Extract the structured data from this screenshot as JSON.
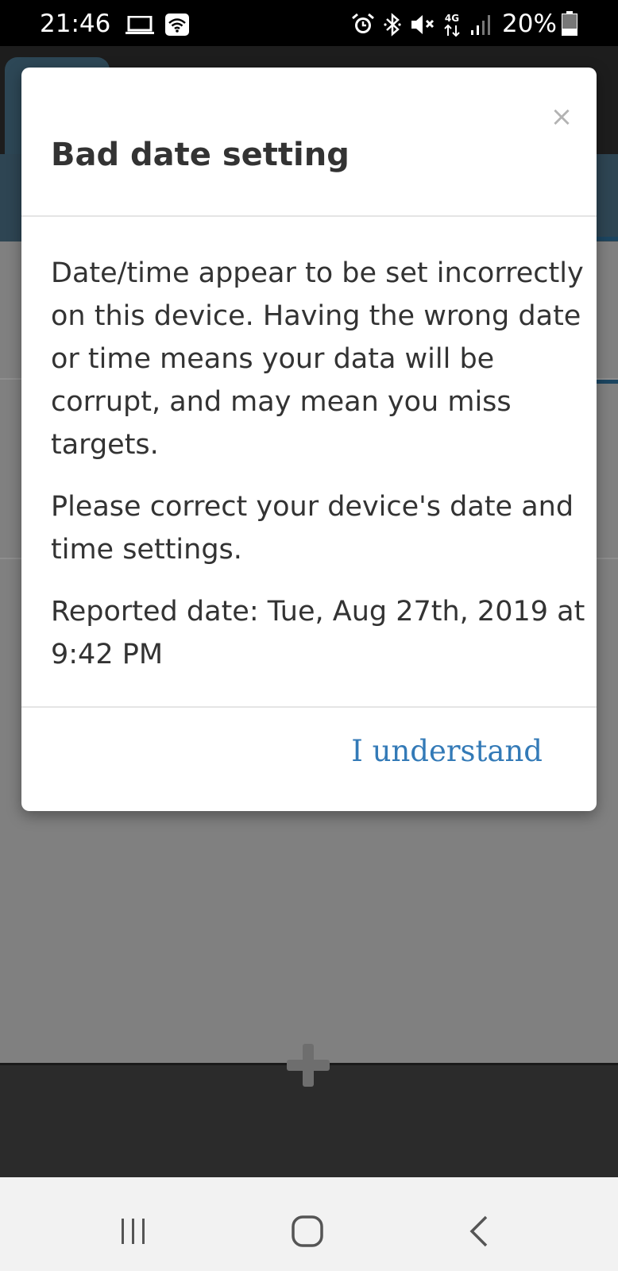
{
  "status_bar": {
    "time": "21:46",
    "battery_percent": "20%",
    "lte_label": "4G",
    "icons": [
      "laptop-icon",
      "wifi-badge-icon",
      "alarm-icon",
      "bluetooth-icon",
      "mute-icon",
      "lte-icon",
      "signal-icon",
      "battery-icon"
    ]
  },
  "dialog": {
    "title": "Bad date setting",
    "close_symbol": "×",
    "paragraphs": [
      "Date/time appear to be set incorrectly on this device. Having the wrong date or time means your data will be corrupt, and may mean you miss targets.",
      "Please correct your device's date and time settings.",
      "Reported date: Tue, Aug 27th, 2019 at 9:42 PM"
    ],
    "confirm_label": "I understand",
    "link_color": "#337ab7"
  },
  "app": {
    "footer_action_icon": "plus-icon"
  },
  "nav_bar": {
    "buttons": [
      "recents-icon",
      "home-icon",
      "back-icon"
    ]
  }
}
